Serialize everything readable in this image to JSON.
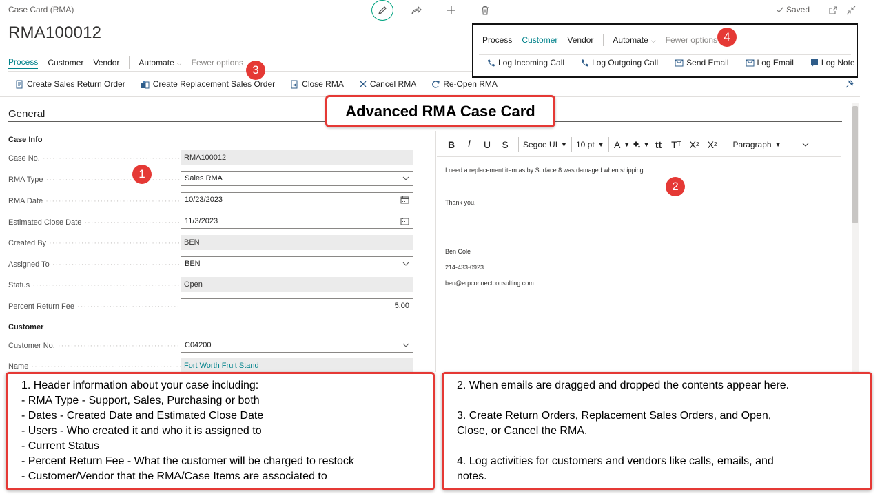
{
  "header": {
    "breadcrumb": "Case Card (RMA)",
    "title": "RMA100012",
    "saved_label": "Saved"
  },
  "nav": {
    "process": "Process",
    "customer": "Customer",
    "vendor": "Vendor",
    "automate": "Automate",
    "fewer_options": "Fewer options"
  },
  "commands": {
    "create_sales_return_order": "Create Sales Return Order",
    "create_replacement_sales_order": "Create Replacement Sales Order",
    "close_rma": "Close RMA",
    "cancel_rma": "Cancel RMA",
    "reopen_rma": "Re-Open RMA"
  },
  "general": {
    "section_title": "General",
    "case_info_title": "Case Info",
    "fields": {
      "case_no": {
        "label": "Case No.",
        "value": "RMA100012"
      },
      "rma_type": {
        "label": "RMA Type",
        "value": "Sales RMA"
      },
      "rma_date": {
        "label": "RMA Date",
        "value": "10/23/2023"
      },
      "estimated_close_date": {
        "label": "Estimated Close Date",
        "value": "11/3/2023"
      },
      "created_by": {
        "label": "Created By",
        "value": "BEN"
      },
      "assigned_to": {
        "label": "Assigned To",
        "value": "BEN"
      },
      "status": {
        "label": "Status",
        "value": "Open"
      },
      "percent_return_fee": {
        "label": "Percent Return Fee",
        "value": "5.00"
      }
    },
    "customer_title": "Customer",
    "customer_fields": {
      "customer_no": {
        "label": "Customer No.",
        "value": "C04200"
      },
      "name": {
        "label": "Name",
        "value": "Fort Worth Fruit Stand"
      }
    }
  },
  "editor": {
    "font": "Segoe UI",
    "size": "10 pt",
    "paragraph": "Paragraph",
    "body_lines": [
      "I need a replacement item as by Surface 8 was damaged when shipping.",
      "Thank you.",
      "Ben Cole",
      "214-433-0923",
      "ben@erpconnectconsulting.com"
    ]
  },
  "popover": {
    "process": "Process",
    "customer": "Customer",
    "vendor": "Vendor",
    "automate": "Automate",
    "fewer_options": "Fewer options",
    "log_incoming_call": "Log Incoming Call",
    "log_outgoing_call": "Log Outgoing Call",
    "send_email": "Send Email",
    "log_email": "Log Email",
    "log_note": "Log Note"
  },
  "callouts": {
    "badge1": "1",
    "badge2": "2",
    "badge3": "3",
    "badge4": "4",
    "banner": "Advanced RMA Case Card",
    "note1": [
      "1. Header information about your case including:",
      "- RMA Type - Support, Sales, Purchasing or both",
      "- Dates - Created Date and Estimated Close Date",
      "- Users - Who created it and who it is assigned to",
      "- Current Status",
      "- Percent Return Fee - What the customer will be charged to restock",
      "- Customer/Vendor that the RMA/Case Items are associated to"
    ],
    "note2_a": "2. When emails are dragged and dropped the contents appear here.",
    "note2_b1": "3. Create Return Orders, Replacement Sales Orders, and Open,",
    "note2_b2": "Close, or Cancel the RMA.",
    "note2_c1": "4. Log activities for customers and vendors like calls, emails, and",
    "note2_c2": "notes."
  },
  "colors": {
    "accent": "#00828b",
    "callout_red": "#e53935",
    "edit_ring": "#00a37f"
  }
}
